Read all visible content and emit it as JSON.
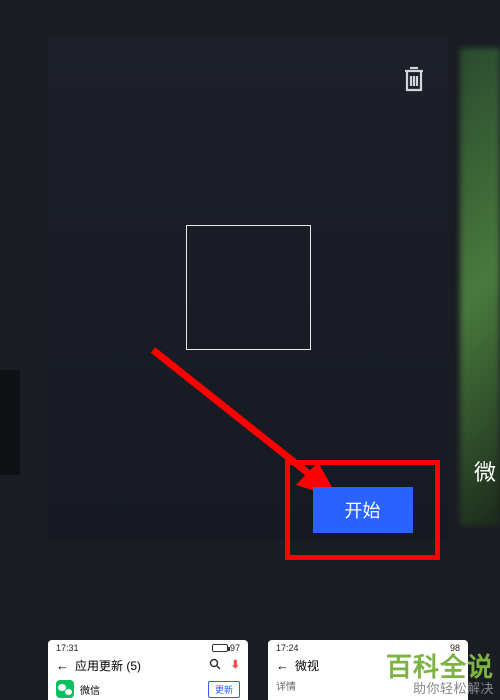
{
  "main_card": {
    "start_button_label": "开始",
    "trash_icon": "trash-icon"
  },
  "side_card": {
    "label_partial": "微"
  },
  "thumbnails": {
    "left": {
      "time": "17:31",
      "battery": "97",
      "title": "应用更新 (5)",
      "app_name": "微信",
      "update_btn": "更新"
    },
    "right": {
      "time": "17:24",
      "battery": "98",
      "title": "微视",
      "subtitle": "详情"
    }
  },
  "watermark": {
    "main": "百科全说",
    "sub": "助你轻松解决"
  }
}
